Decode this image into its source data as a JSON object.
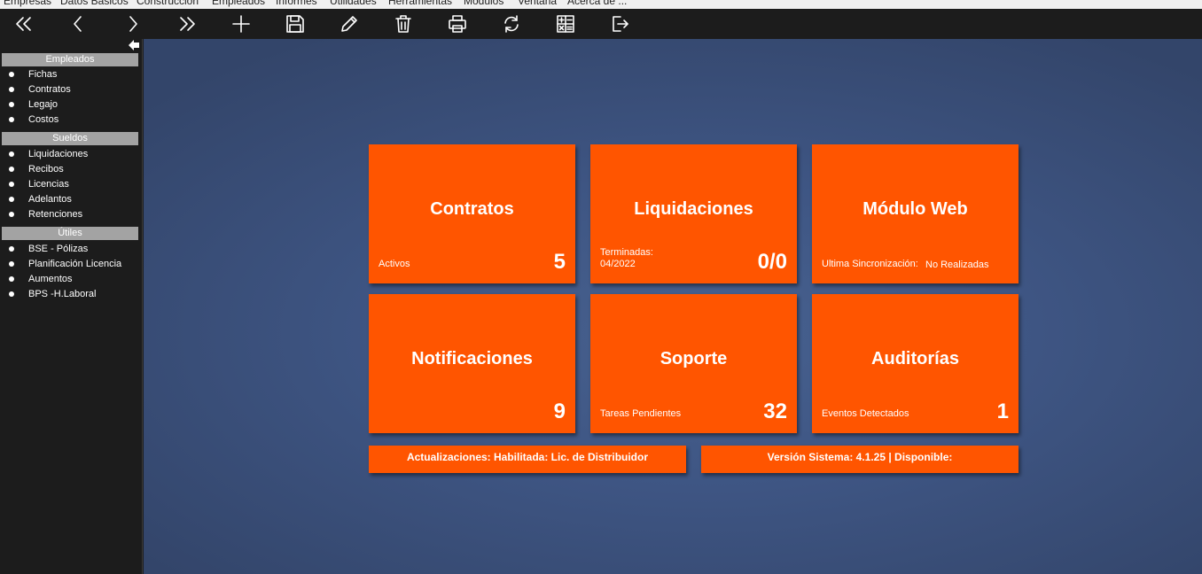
{
  "menu": [
    "Empresas",
    "Datos Básicos",
    "Construcción",
    "Empleados",
    "Informes",
    "Utilidades",
    "Herramientas",
    "Módulos",
    "Ventana",
    "Acerca de ..."
  ],
  "toolbar": {
    "icons": [
      "first-icon",
      "previous-icon",
      "next-icon",
      "last-icon",
      "add-icon",
      "save-icon",
      "edit-icon",
      "delete-icon",
      "print-icon",
      "refresh-icon",
      "calculator-icon",
      "exit-icon"
    ]
  },
  "sidebar": {
    "sections": [
      {
        "title": "Empleados",
        "items": [
          "Fichas",
          "Contratos",
          "Legajo",
          "Costos"
        ]
      },
      {
        "title": "Sueldos",
        "items": [
          "Liquidaciones",
          "Recibos",
          "Licencias",
          "Adelantos",
          "Retenciones"
        ]
      },
      {
        "title": "Útiles",
        "items": [
          "BSE - Pólizas",
          "Planificación Licencia",
          "Aumentos",
          "BPS -H.Laboral"
        ]
      }
    ]
  },
  "tiles": {
    "contratos": {
      "title": "Contratos",
      "label": "Activos",
      "count": "5"
    },
    "liquidaciones": {
      "title": "Liquidaciones",
      "label": "Terminadas:",
      "label2": "04/2022",
      "count": "0/0"
    },
    "web": {
      "title": "Módulo Web",
      "label": "Ultima Sincronización:",
      "extra": "No Realizadas"
    },
    "notificaciones": {
      "title": "Notificaciones",
      "count": "9"
    },
    "soporte": {
      "title": "Soporte",
      "label": "Tareas Pendientes",
      "count": "32"
    },
    "auditorias": {
      "title": "Auditorías",
      "label": "Eventos Detectados",
      "count": "1"
    }
  },
  "footer": {
    "updates": "Actualizaciones: Habilitada: Lic. de Distribuidor",
    "version": "Versión Sistema: 4.1.25 | Disponible:"
  },
  "colors": {
    "tile": "#ff5500",
    "background": "#3e5583",
    "sidebar": "#1c1c1c",
    "section_header": "#a3a3a3"
  }
}
